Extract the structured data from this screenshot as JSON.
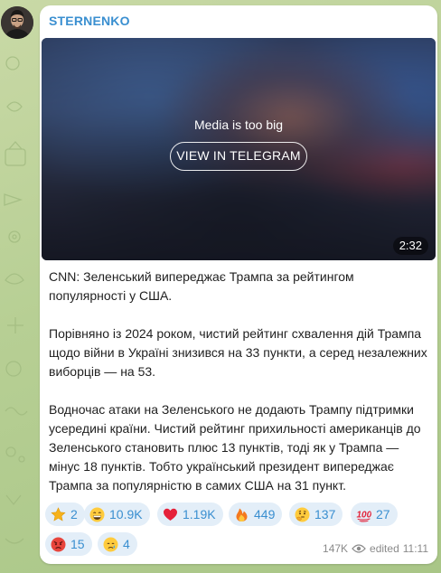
{
  "channel": {
    "name": "STERNENKO"
  },
  "media": {
    "notice": "Media is too big",
    "button_label": "VIEW IN TELEGRAM",
    "duration": "2:32"
  },
  "post": {
    "paragraphs": [
      "CNN: Зеленський випереджає Трампа за рейтингом популярності у США.",
      "Порівняно із 2024 роком, чистий рейтинг схвалення дій Трампа щодо війни в Україні знизився на 33 пункти, а серед незалежних виборців — на 53.",
      "Водночас атаки на Зеленського не додають Трампу підтримки усередині країни. Чистий рейтинг прихильності американців до Зеленського становить плюс 13 пунктів, тоді як у Трампа — мінус 18 пунктів. Тобто український президент випереджає Трампа за популярністю в самих США на 31 пункт."
    ]
  },
  "reactions": [
    {
      "icon": "star-icon",
      "count": "2"
    },
    {
      "icon": "grinning-face-icon",
      "count": "10.9K"
    },
    {
      "icon": "red-heart-icon",
      "count": "1.19K"
    },
    {
      "icon": "fire-icon",
      "count": "449"
    },
    {
      "icon": "thinking-face-icon",
      "count": "137"
    },
    {
      "icon": "hundred-points-icon",
      "count": "27"
    },
    {
      "icon": "angry-face-icon",
      "count": "15"
    },
    {
      "icon": "crying-face-icon",
      "count": "4"
    }
  ],
  "footer": {
    "views": "147K",
    "status": "edited",
    "time": "11:11"
  },
  "colors": {
    "accent": "#3a8fd0",
    "reaction_bg": "#e3eef8",
    "chat_bg": "#b7cf94"
  }
}
